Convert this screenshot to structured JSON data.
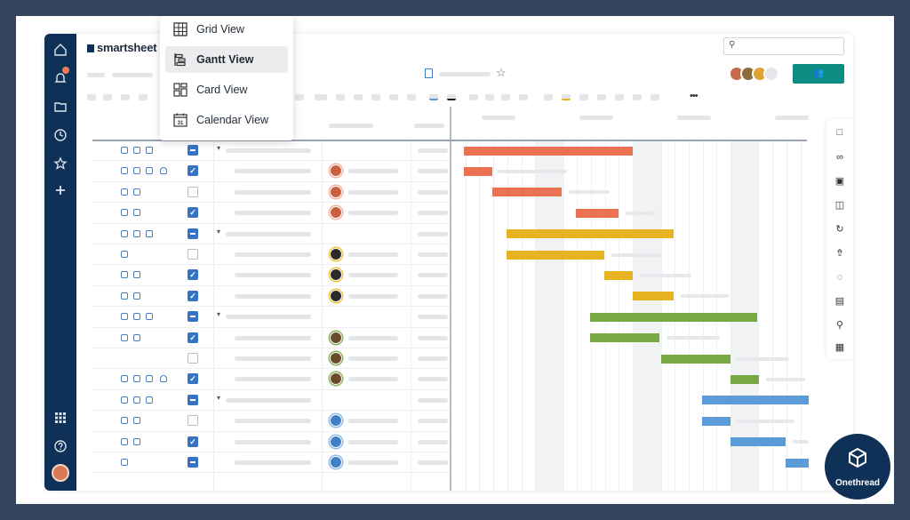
{
  "app": {
    "logo_text": "smartsheet"
  },
  "view_menu": {
    "items": [
      {
        "label": "Grid View",
        "icon": "grid-icon",
        "active": false
      },
      {
        "label": "Gantt View",
        "icon": "gantt-icon",
        "active": true
      },
      {
        "label": "Card View",
        "icon": "card-icon",
        "active": false
      },
      {
        "label": "Calendar View",
        "icon": "calendar-icon",
        "active": false
      }
    ]
  },
  "calendar_icon_text": "31",
  "toolbar": {
    "more_label": "•••"
  },
  "brand": {
    "name": "Onethread"
  },
  "colors": {
    "nav": "#0f3057",
    "accent": "#0d8c84",
    "checkbox": "#3673c3",
    "bar_orange": "#ec7152",
    "bar_yellow": "#e8b320",
    "bar_green": "#76a843",
    "bar_blue": "#5b9bd8"
  },
  "rows": [
    {
      "icons": 3,
      "check": "parent",
      "parent": true,
      "person": null
    },
    {
      "icons": 4,
      "check": "checked",
      "parent": false,
      "person": "orange"
    },
    {
      "icons": 2,
      "check": "empty",
      "parent": false,
      "person": "orange"
    },
    {
      "icons": 2,
      "check": "checked",
      "parent": false,
      "person": "orange"
    },
    {
      "icons": 3,
      "check": "parent",
      "parent": true,
      "person": null
    },
    {
      "icons": 1,
      "check": "empty",
      "parent": false,
      "person": "yellow"
    },
    {
      "icons": 2,
      "check": "checked",
      "parent": false,
      "person": "yellow"
    },
    {
      "icons": 2,
      "check": "checked",
      "parent": false,
      "person": "yellow"
    },
    {
      "icons": 3,
      "check": "parent",
      "parent": true,
      "person": null
    },
    {
      "icons": 2,
      "check": "checked",
      "parent": false,
      "person": "green"
    },
    {
      "icons": 0,
      "check": "empty",
      "parent": false,
      "person": "green"
    },
    {
      "icons": 4,
      "check": "checked",
      "parent": false,
      "person": "green"
    },
    {
      "icons": 3,
      "check": "parent",
      "parent": true,
      "person": null
    },
    {
      "icons": 2,
      "check": "empty",
      "parent": false,
      "person": "blue"
    },
    {
      "icons": 2,
      "check": "checked",
      "parent": false,
      "person": "blue"
    },
    {
      "icons": 1,
      "check": "parent",
      "parent": false,
      "person": "blue"
    }
  ]
}
